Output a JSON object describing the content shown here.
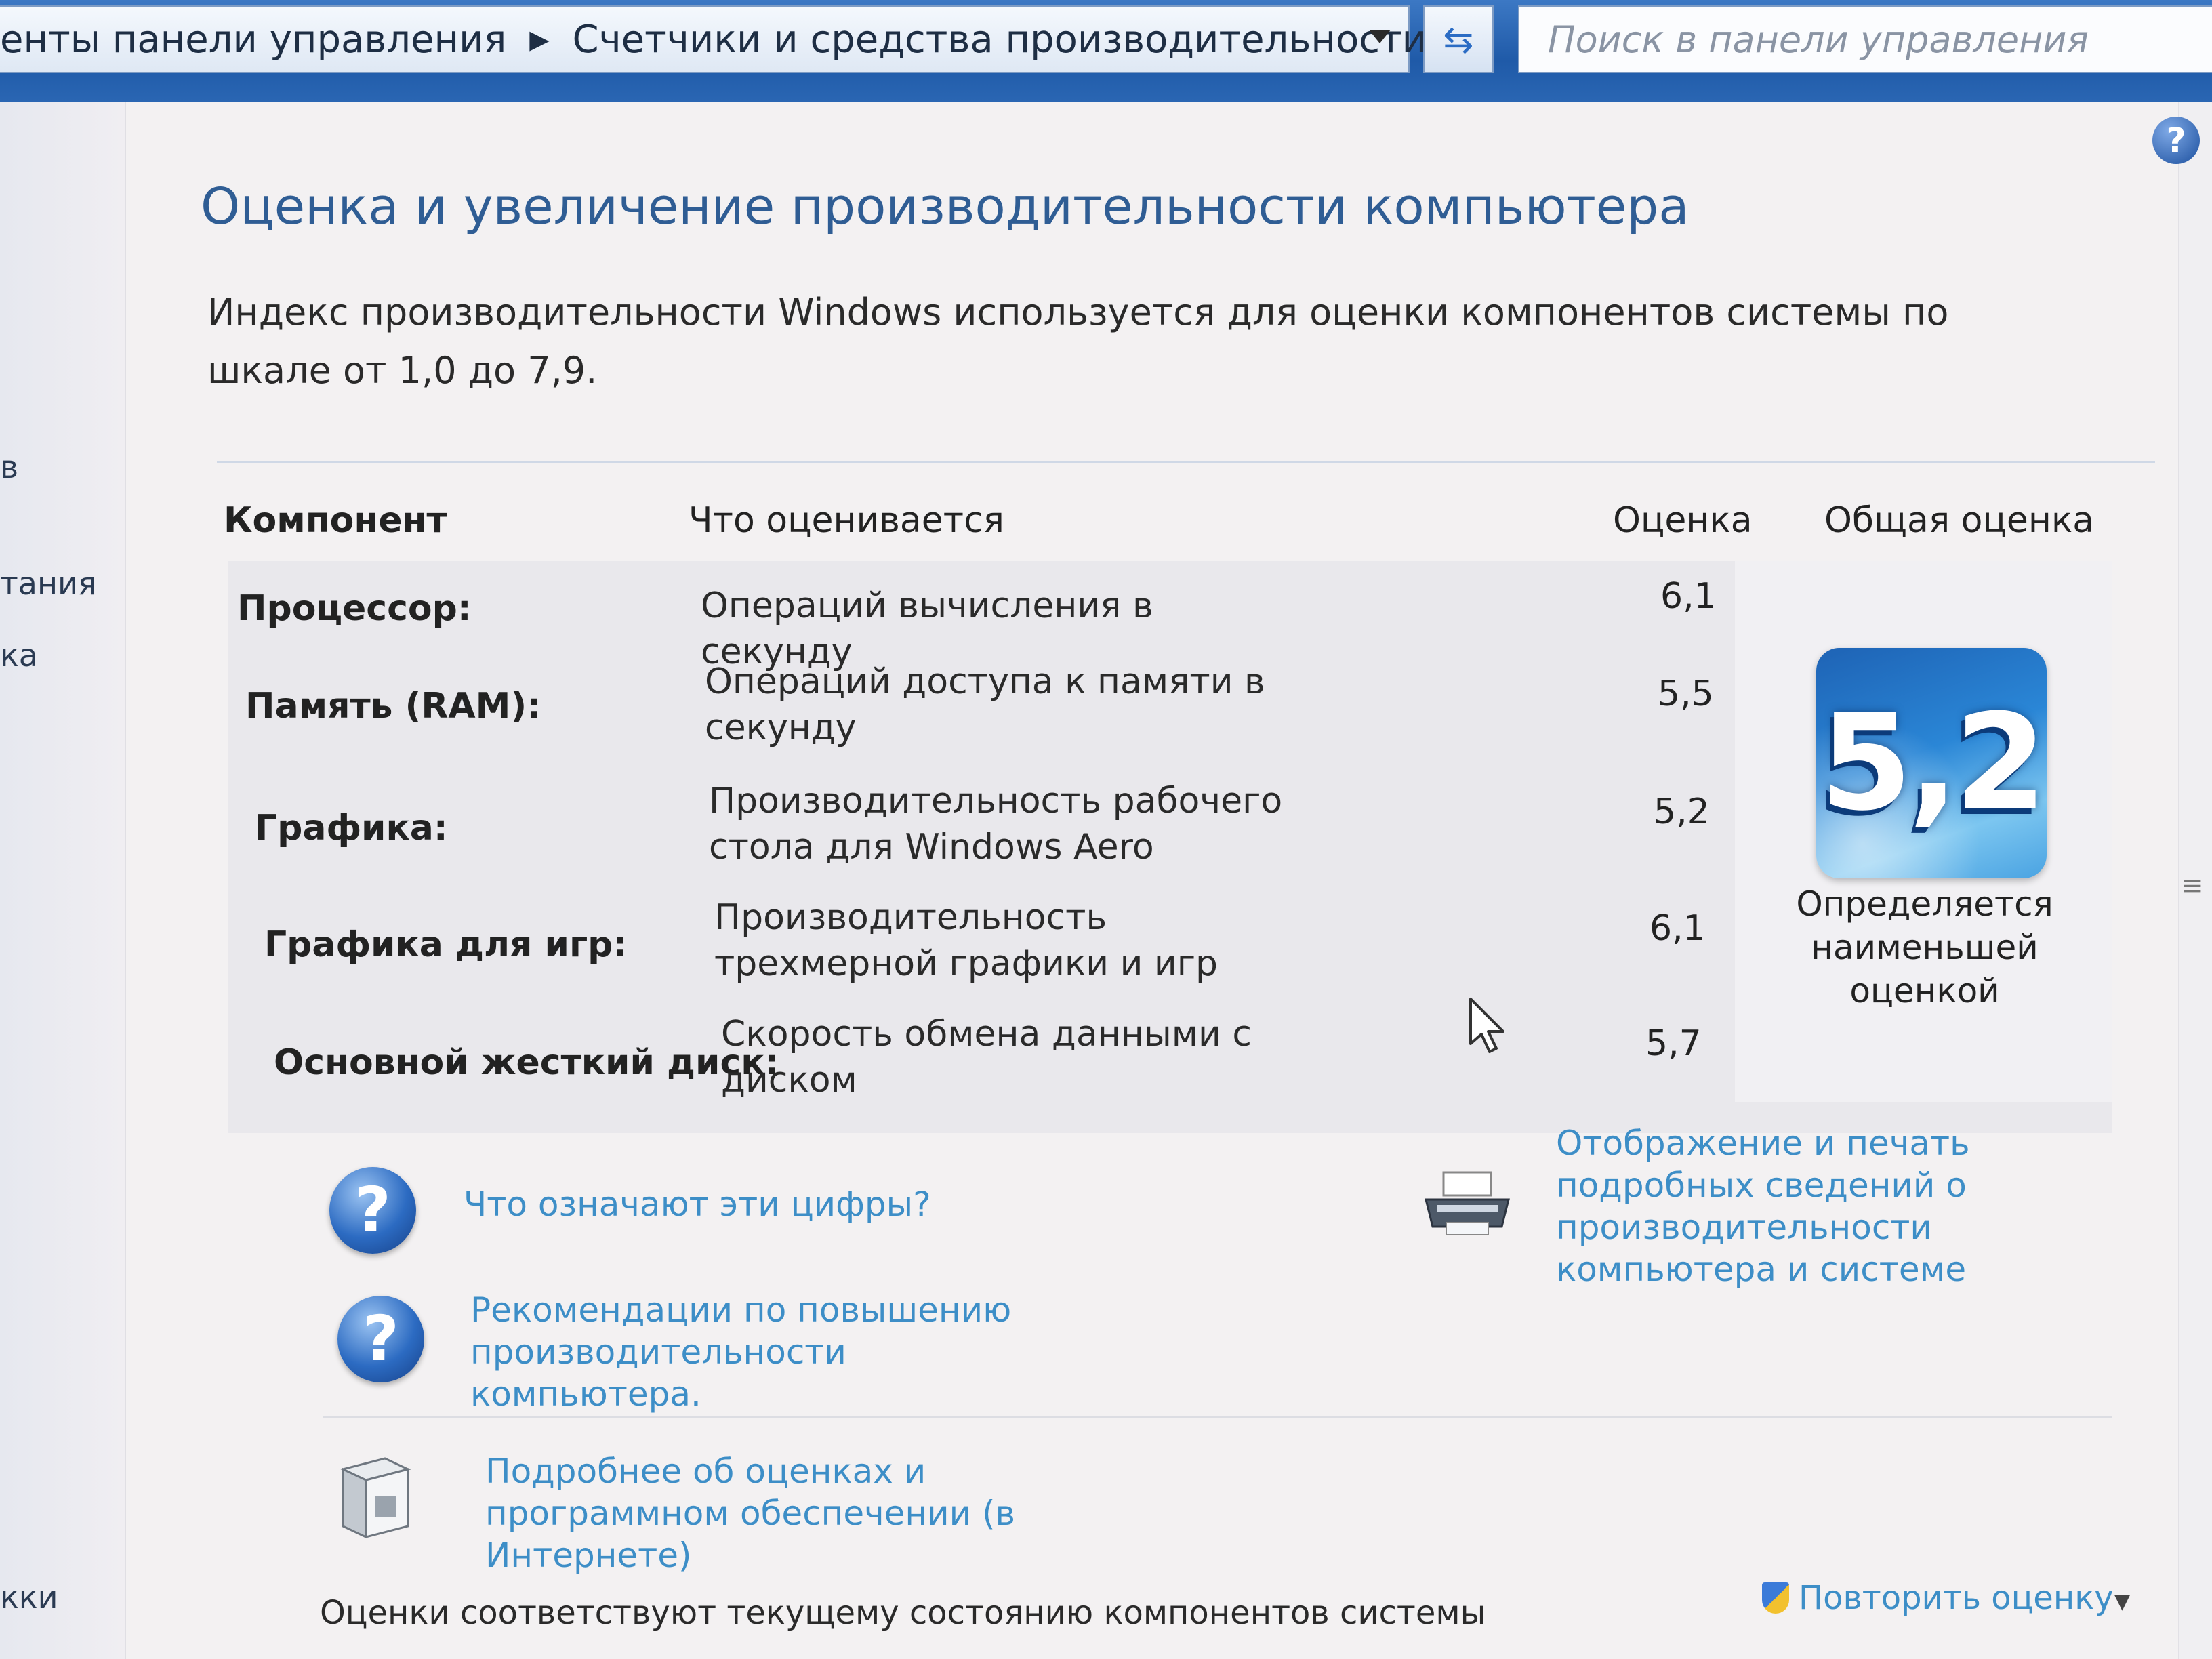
{
  "address_bar": {
    "crumb_1": "енты панели управления",
    "crumb_2": "Счетчики и средства производительности",
    "search_placeholder": "Поиск в панели управления"
  },
  "left_nav": {
    "items": [
      "в",
      "тания",
      "ка",
      "кки"
    ]
  },
  "page": {
    "title": "Оценка и увеличение производительности компьютера",
    "intro": "Индекс производительности Windows используется для оценки компонентов системы по шкале от 1,0 до 7,9."
  },
  "table": {
    "headers": {
      "component": "Компонент",
      "what": "Что оценивается",
      "score": "Оценка",
      "base": "Общая оценка"
    },
    "rows": [
      {
        "component": "Процессор:",
        "what": "Операций вычисления в секунду",
        "score": "6,1"
      },
      {
        "component": "Память (RAM):",
        "what": "Операций доступа к памяти в секунду",
        "score": "5,5"
      },
      {
        "component": "Графика:",
        "what": "Производительность рабочего стола для Windows Aero",
        "score": "5,2"
      },
      {
        "component": "Графика для игр:",
        "what": "Производительность трехмерной графики и игр",
        "score": "6,1"
      },
      {
        "component": "Основной жесткий диск:",
        "what": "Скорость обмена данными с диском",
        "score": "5,7"
      }
    ],
    "base_score": "5,2",
    "base_note": "Определяется наименьшей оценкой"
  },
  "links": {
    "what_numbers": "Что означают эти цифры?",
    "tips": "Рекомендации по повышению производительности компьютера.",
    "print_details": "Отображение и печать подробных сведений о производительности компьютера и системе",
    "more_online": "Подробнее об оценках и программном обеспечении (в Интернете)"
  },
  "footer": {
    "status": "Оценки соответствуют текущему состоянию компонентов системы",
    "rerun": "Повторить оценку"
  },
  "colors": {
    "accent_blue": "#2f5d94",
    "link_blue": "#3d8ec7",
    "titlebar_blue": "#1f5aa8"
  }
}
